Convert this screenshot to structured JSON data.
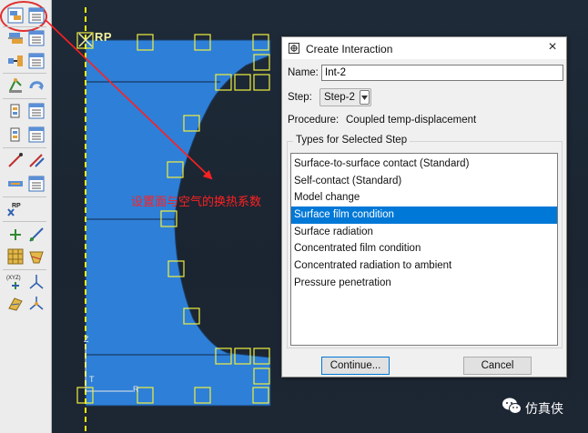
{
  "viewport": {
    "rp_label": "RP",
    "annotation": "设置面与空气的换热系数",
    "axis_labels": {
      "z": "Z",
      "t": "T",
      "r": "R"
    },
    "colors": {
      "part": "#2e7fd7",
      "highlight_box": "#f0f040",
      "annotation": "#ff2020",
      "axis_line": "#f2f200"
    }
  },
  "toolbox": {
    "tools": [
      "create-interaction-icon",
      "interaction-manager-icon",
      "create-interaction-property-icon",
      "interaction-property-manager-icon",
      "create-constraint-icon",
      "constraint-manager-icon",
      "create-connector-icon",
      "connector-manager-icon",
      "create-wire-icon",
      "wire-manager-icon",
      "create-attachment-icon",
      "attachment-manager-icon",
      "create-fastener-icon",
      "fastener-manager-icon",
      "create-cable-icon",
      "cable-manager-icon",
      "reference-point-icon",
      "create-datum-point-icon",
      "create-datum-axis-icon",
      "partition-cell-icon",
      "partition-face-icon",
      "create-csys-icon",
      "triad-icon",
      "query-icon",
      "tie-icon"
    ],
    "rp_tool_label": "RP",
    "csys_tool_label": "(XYZ)"
  },
  "dialog": {
    "title": "Create Interaction",
    "close_glyph": "×",
    "name_label": "Name:",
    "name_value": "Int-2",
    "step_label": "Step:",
    "step_value": "Step-2",
    "procedure_label": "Procedure:",
    "procedure_value": "Coupled temp-displacement",
    "types_legend": "Types for Selected Step",
    "types": [
      "Surface-to-surface contact (Standard)",
      "Self-contact (Standard)",
      "Model change",
      "Surface film condition",
      "Surface radiation",
      "Concentrated film condition",
      "Concentrated radiation to ambient",
      "Pressure penetration"
    ],
    "selected_type": "Surface film condition",
    "continue_label": "Continue...",
    "cancel_label": "Cancel"
  },
  "watermark": {
    "text": "仿真侠",
    "icon": "wechat-icon"
  }
}
